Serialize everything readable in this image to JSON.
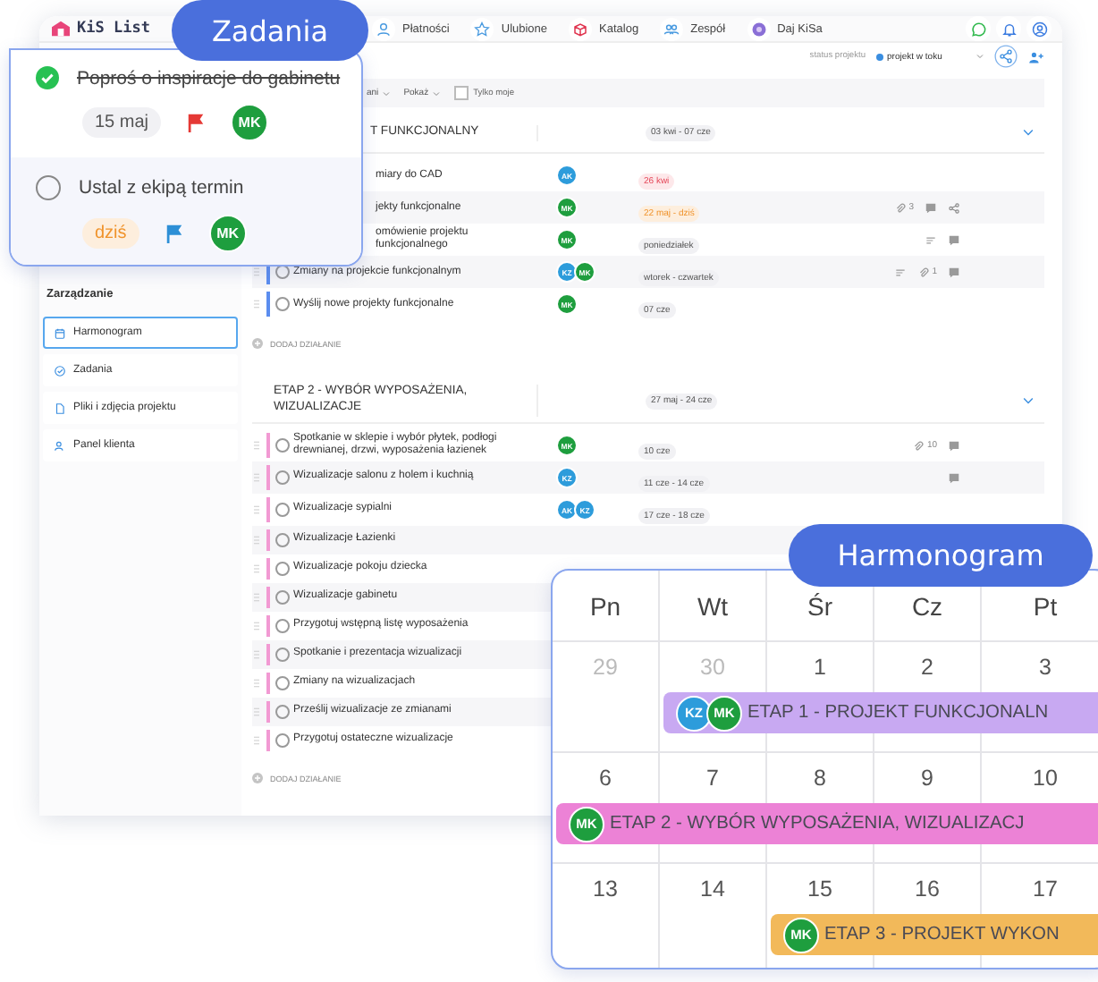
{
  "app": {
    "logo": "KiS List",
    "nav": [
      {
        "label": "Płatności",
        "kind": "wallet"
      },
      {
        "label": "Ulubione",
        "kind": "star"
      },
      {
        "label": "Katalog",
        "kind": "box"
      },
      {
        "label": "Zespół",
        "kind": "team"
      },
      {
        "label": "Daj KiSa",
        "kind": "gift"
      }
    ],
    "tools": [
      {
        "kind": "chat"
      },
      {
        "kind": "bell"
      },
      {
        "kind": "user"
      }
    ],
    "status_label": "status projektu",
    "status_value": "projekt w toku",
    "filters": [
      {
        "kind": "dropdown",
        "label": "ani"
      },
      {
        "kind": "dropdown",
        "label": "Pokaż"
      },
      {
        "kind": "checkbox",
        "label": "Tylko moje",
        "checked": false
      }
    ],
    "sidebar": {
      "heading": "Zarządzanie",
      "items": [
        {
          "label": "Harmonogram",
          "kind": "calendar",
          "selected": true
        },
        {
          "label": "Zadania",
          "kind": "check",
          "selected": false
        },
        {
          "label": "Pliki i zdjęcia projektu",
          "kind": "file",
          "selected": false
        },
        {
          "label": "Panel klienta",
          "kind": "person",
          "selected": false
        }
      ]
    },
    "stages": [
      {
        "title": "T FUNKCJONALNY",
        "dates": "03 kwi - 07 cze",
        "color": "#5b8def",
        "add_label": "DODAJ DZIAŁANIE",
        "rows": [
          {
            "text": "miary do CAD",
            "avatars": [
              {
                "initials": "AK",
                "color": "#2d9cdb"
              }
            ],
            "date": {
              "text": "26 kwi",
              "kind": "overdue"
            },
            "icons": []
          },
          {
            "text": "jekty funkcjonalne",
            "avatars": [
              {
                "initials": "MK",
                "color": "#1e9e3e"
              }
            ],
            "date": {
              "text": "22 maj - dziś",
              "kind": "today"
            },
            "icons": [
              {
                "kind": "attachment",
                "count": "3"
              },
              {
                "kind": "comment"
              },
              {
                "kind": "share"
              }
            ]
          },
          {
            "text": "omówienie projektu funkcjonalnego",
            "avatars": [
              {
                "initials": "MK",
                "color": "#1e9e3e"
              }
            ],
            "date": {
              "text": "poniedziałek",
              "kind": "plain"
            },
            "icons": [
              {
                "kind": "notes"
              },
              {
                "kind": "comment"
              }
            ]
          },
          {
            "text": "Zmiany na projekcie funkcjonalnym",
            "done": false,
            "avatars": [
              {
                "initials": "KZ",
                "color": "#2d9cdb"
              },
              {
                "initials": "MK",
                "color": "#1e9e3e"
              }
            ],
            "date": {
              "text": "wtorek - czwartek",
              "kind": "plain"
            },
            "icons": [
              {
                "kind": "notes"
              },
              {
                "kind": "attachment",
                "count": "1"
              },
              {
                "kind": "comment"
              }
            ]
          },
          {
            "text": "Wyślij nowe projekty funkcjonalne",
            "done": false,
            "avatars": [
              {
                "initials": "MK",
                "color": "#1e9e3e"
              }
            ],
            "date": {
              "text": "07 cze",
              "kind": "plain"
            },
            "icons": []
          }
        ]
      },
      {
        "title": "ETAP 2 - WYBÓR WYPOSAŻENIA, WIZUALIZACJE",
        "dates": "27 maj - 24 cze",
        "color": "#f29ad3",
        "add_label": "DODAJ DZIAŁANIE",
        "rows": [
          {
            "text": "Spotkanie w sklepie i wybór płytek, podłogi drewnianej, drzwi, wyposażenia łazienek",
            "done": false,
            "avatars": [
              {
                "initials": "MK",
                "color": "#1e9e3e"
              }
            ],
            "date": {
              "text": "10 cze",
              "kind": "plain"
            },
            "icons": [
              {
                "kind": "attachment",
                "count": "10"
              },
              {
                "kind": "comment"
              }
            ]
          },
          {
            "text": "Wizualizacje salonu z holem i kuchnią",
            "done": false,
            "avatars": [
              {
                "initials": "KZ",
                "color": "#2d9cdb"
              }
            ],
            "date": {
              "text": "11 cze - 14 cze",
              "kind": "plain"
            },
            "icons": [
              {
                "kind": "comment"
              }
            ]
          },
          {
            "text": "Wizualizacje sypialni",
            "done": false,
            "avatars": [
              {
                "initials": "AK",
                "color": "#2d9cdb"
              },
              {
                "initials": "KZ",
                "color": "#2d9cdb"
              }
            ],
            "date": {
              "text": "17 cze - 18 cze",
              "kind": "plain"
            },
            "icons": []
          },
          {
            "text": "Wizualizacje Łazienki",
            "done": false,
            "avatars": [],
            "icons": []
          },
          {
            "text": "Wizualizacje pokoju dziecka",
            "done": false,
            "avatars": [],
            "icons": []
          },
          {
            "text": "Wizualizacje gabinetu",
            "done": false,
            "avatars": [],
            "icons": []
          },
          {
            "text": "Przygotuj wstępną listę wyposażenia",
            "done": false,
            "avatars": [],
            "icons": []
          },
          {
            "text": "Spotkanie i prezentacja wizualizacji",
            "done": false,
            "avatars": [],
            "icons": []
          },
          {
            "text": "Zmiany na wizualizacjach",
            "done": false,
            "avatars": [],
            "icons": []
          },
          {
            "text": "Prześlij wizualizacje ze zmianami",
            "done": false,
            "avatars": [],
            "icons": []
          },
          {
            "text": "Przygotuj ostateczne wizualizacje",
            "done": false,
            "avatars": [],
            "icons": []
          }
        ]
      }
    ]
  },
  "tasks_popup": {
    "title": "Zadania",
    "tasks": [
      {
        "text": "Poproś o inspiracje do gabinetu",
        "done": true,
        "date": {
          "text": "15 maj",
          "kind": "plain"
        },
        "flag": {
          "color": "#e53935"
        },
        "assignee": "MK"
      },
      {
        "text": "Ustal z ekipą termin",
        "done": false,
        "date": {
          "text": "dziś",
          "kind": "today"
        },
        "flag": {
          "color": "#2d8fd6"
        },
        "assignee": "MK"
      }
    ]
  },
  "schedule_popup": {
    "title": "Harmonogram",
    "weekdays": [
      "Pn",
      "Wt",
      "Śr",
      "Cz",
      "Pt"
    ],
    "weeks": [
      {
        "days": [
          {
            "label": "29",
            "muted": true
          },
          {
            "label": "30",
            "muted": true,
            "event": {
              "title": "ETAP 1 - PROJEKT FUNKCJONALN",
              "color": "#c8a9f2",
              "avatars": [
                {
                  "initials": "KZ",
                  "color": "#2d9cdb"
                },
                {
                  "initials": "MK",
                  "color": "#1e9e3e"
                }
              ]
            }
          },
          {
            "label": "1",
            "muted": false
          },
          {
            "label": "2",
            "muted": false
          },
          {
            "label": "3",
            "muted": false
          }
        ]
      },
      {
        "days": [
          {
            "label": "6",
            "muted": false,
            "event": {
              "title": "ETAP 2 - WYBÓR WYPOSAŻENIA, WIZUALIZACJ",
              "color": "#ec82d6",
              "avatars": [
                {
                  "initials": "MK",
                  "color": "#1e9e3e"
                }
              ]
            }
          },
          {
            "label": "7",
            "muted": false
          },
          {
            "label": "8",
            "muted": false
          },
          {
            "label": "9",
            "muted": false
          },
          {
            "label": "10",
            "muted": false
          }
        ]
      },
      {
        "days": [
          {
            "label": "13",
            "muted": false
          },
          {
            "label": "14",
            "muted": false
          },
          {
            "label": "15",
            "muted": false,
            "event": {
              "title": "ETAP 3 - PROJEKT WYKON",
              "color": "#f2b95a",
              "avatars": [
                {
                  "initials": "MK",
                  "color": "#1e9e3e"
                }
              ]
            }
          },
          {
            "label": "16",
            "muted": false
          },
          {
            "label": "17",
            "muted": false
          }
        ]
      }
    ]
  }
}
